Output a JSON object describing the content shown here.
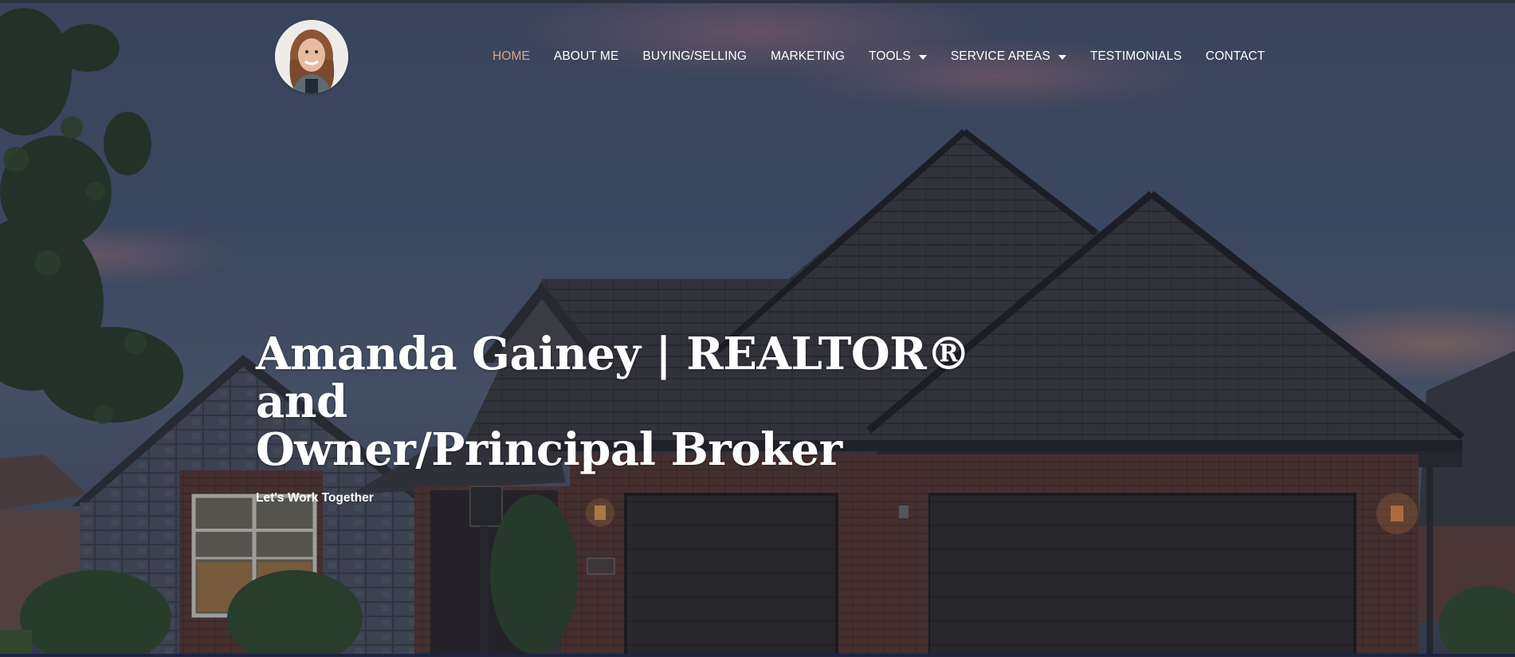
{
  "nav": {
    "items": [
      {
        "label": "HOME",
        "active": true,
        "dropdown": false
      },
      {
        "label": "ABOUT ME",
        "active": false,
        "dropdown": false
      },
      {
        "label": "BUYING/SELLING",
        "active": false,
        "dropdown": false
      },
      {
        "label": "MARKETING",
        "active": false,
        "dropdown": false
      },
      {
        "label": "TOOLS",
        "active": false,
        "dropdown": true
      },
      {
        "label": "SERVICE AREAS",
        "active": false,
        "dropdown": true
      },
      {
        "label": "TESTIMONIALS",
        "active": false,
        "dropdown": false
      },
      {
        "label": "CONTACT",
        "active": false,
        "dropdown": false
      }
    ]
  },
  "hero": {
    "title_line1": "Amanda Gainey | REALTOR® and",
    "title_line2": "Owner/Principal Broker",
    "subtitle": "Let's Work Together"
  },
  "colors": {
    "active_nav": "#d7a689",
    "nav_text": "#ffffff",
    "sky": "#3d4a60",
    "roof": "#3a3a3c",
    "brick": "#5e3a32"
  },
  "icons": {
    "logo": "agent-portrait-logo",
    "dropdown": "caret-down-icon"
  }
}
